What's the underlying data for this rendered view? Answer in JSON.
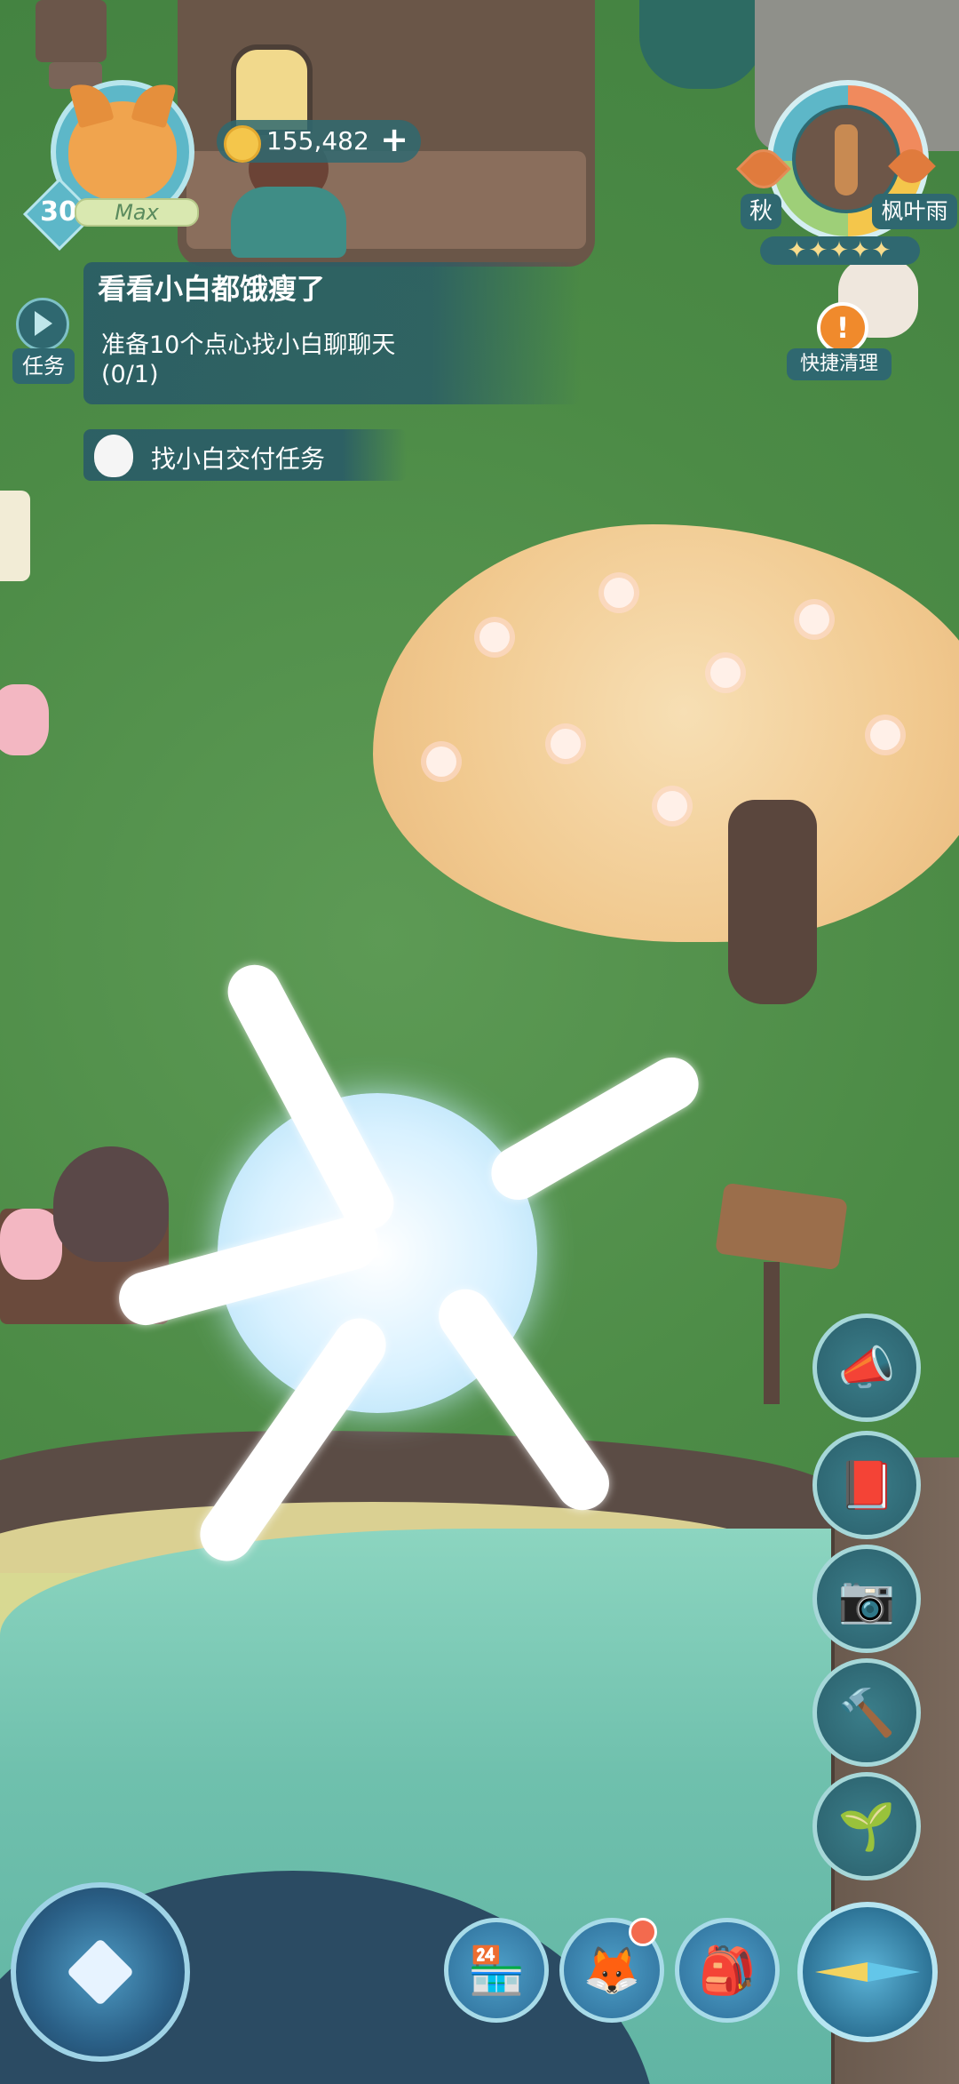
{
  "player": {
    "level": "30",
    "level_status": "Max",
    "coins": "155,482",
    "coin_add_label": "+"
  },
  "environment": {
    "season": "秋",
    "weather": "枫叶雨",
    "rating_stars": "✦✦✦✦✦",
    "quick_clean_icon": "!",
    "quick_clean_label": "快捷清理"
  },
  "quest": {
    "toggle_label": "任务",
    "title": "看看小白都饿瘦了",
    "description": "准备10个点心找小白聊聊天",
    "progress": "(0/1)",
    "sub_task": "找小白交付任务"
  },
  "side_buttons": [
    {
      "name": "megaphone-button",
      "icon": "📣"
    },
    {
      "name": "journal-button",
      "icon": "📕"
    },
    {
      "name": "camera-button",
      "icon": "📷"
    },
    {
      "name": "hammer-button",
      "icon": "🔨"
    },
    {
      "name": "sprout-button",
      "icon": "🌱"
    }
  ],
  "bottom_buttons": [
    {
      "name": "shop-button",
      "icon": "🏪"
    },
    {
      "name": "pet-button",
      "icon": "🦊"
    },
    {
      "name": "backpack-button",
      "icon": "🎒"
    }
  ],
  "colors": {
    "hud_panel": "#2f6870",
    "grass": "#4f8f4a",
    "tree_canopy": "#f1c98f",
    "notification": "#f36a4e"
  }
}
